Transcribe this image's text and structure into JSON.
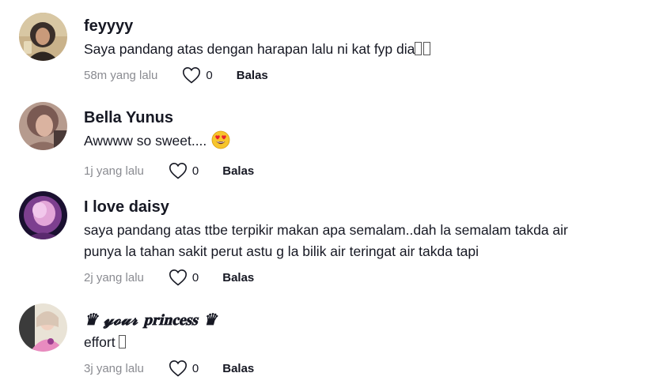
{
  "comments": [
    {
      "username": "feyyyy",
      "text": "Saya pandang atas dengan harapan lalu ni kat fyp dia",
      "time": "58m yang lalu",
      "likes": "0",
      "reply": "Balas"
    },
    {
      "username": "Bella Yunus",
      "text": "Awwww so sweet....",
      "time": "1j yang lalu",
      "likes": "0",
      "reply": "Balas"
    },
    {
      "username": "I love daisy",
      "text": "saya pandang atas ttbe terpikir makan apa semalam..dah la semalam takda air punya la tahan sakit perut astu g la bilik air teringat air takda tapi",
      "time": "2j yang lalu",
      "likes": "0",
      "reply": "Balas"
    },
    {
      "username": "♛ 𝔂𝓸𝓾𝓻 𝐩𝐫𝐢𝐧𝐜𝐞𝐬𝐬 ♛",
      "text": "effort",
      "time": "3j yang lalu",
      "likes": "0",
      "reply": "Balas"
    }
  ],
  "colors": {
    "primary_text": "#161823",
    "secondary_text": "#8a8b91"
  },
  "icons": {
    "like": "heart-outline-icon",
    "emoji": "heart-eyes-emoji"
  }
}
